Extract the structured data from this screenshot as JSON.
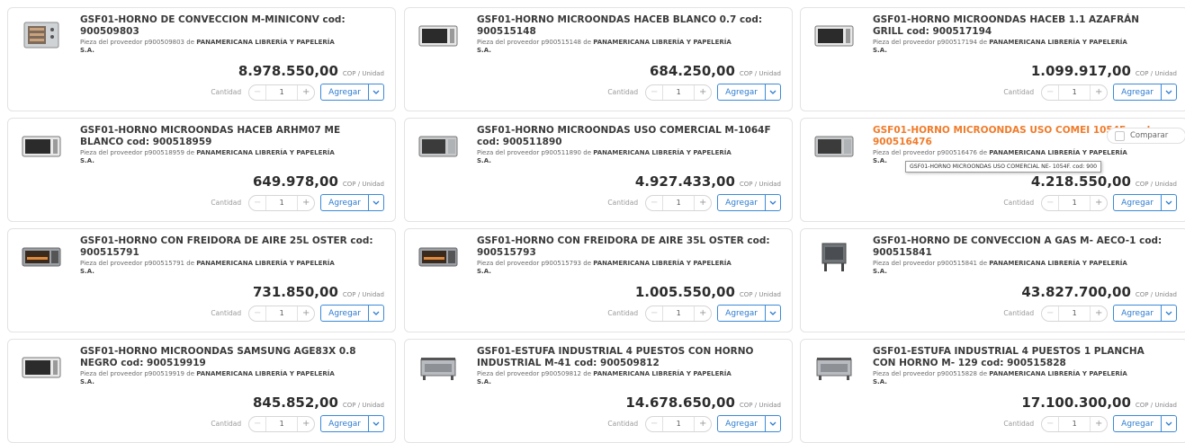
{
  "labels": {
    "provider_prefix": "Pieza del proveedor",
    "provider_of": "de",
    "unit": "COP / Unidad",
    "quantity": "Cantidad",
    "add": "Agregar",
    "compare": "Comparar",
    "minus": "−",
    "plus": "+"
  },
  "products": [
    {
      "title": "GSF01-HORNO DE CONVECCION M-MINICONV cod: 900509803",
      "provider_code": "p900509803",
      "provider": "PANAMERICANA LIBRERÍA Y PAPELERÍA S.A.",
      "price": "8.978.550,00",
      "qty": "1",
      "thumb": "convection-oven-icon",
      "highlighted": false
    },
    {
      "title": "GSF01-HORNO MICROONDAS HACEB BLANCO 0.7 cod: 900515148",
      "provider_code": "p900515148",
      "provider": "PANAMERICANA LIBRERÍA Y PAPELERÍA S.A.",
      "price": "684.250,00",
      "qty": "1",
      "thumb": "microwave-icon",
      "highlighted": false
    },
    {
      "title": "GSF01-HORNO MICROONDAS HACEB 1.1 AZAFRÁN GRILL cod: 900517194",
      "provider_code": "p900517194",
      "provider": "PANAMERICANA LIBRERÍA Y PAPELERÍA S.A.",
      "price": "1.099.917,00",
      "qty": "1",
      "thumb": "microwave-icon",
      "highlighted": false
    },
    {
      "title": "GSF01-HORNO MICROONDAS HACEB ARHM07 ME BLANCO cod: 900518959",
      "provider_code": "p900518959",
      "provider": "PANAMERICANA LIBRERÍA Y PAPELERÍA S.A.",
      "price": "649.978,00",
      "qty": "1",
      "thumb": "microwave-icon",
      "highlighted": false
    },
    {
      "title": "GSF01-HORNO MICROONDAS USO COMERCIAL M-1064F cod: 900511890",
      "provider_code": "p900511890",
      "provider": "PANAMERICANA LIBRERÍA Y PAPELERÍA S.A.",
      "price": "4.927.433,00",
      "qty": "1",
      "thumb": "commercial-microwave-icon",
      "highlighted": false
    },
    {
      "title": "GSF01-HORNO MICROONDAS USO COMEI 1054F. cod: 900516476",
      "provider_code": "p900516476",
      "provider": "PANAMERICANA LIBRERÍA Y PAPELERÍA S.A.",
      "price": "4.218.550,00",
      "qty": "1",
      "thumb": "commercial-microwave-icon",
      "highlighted": true,
      "tooltip": "GSF01-HORNO MICROONDAS USO COMERCIAL NE- 1054F. cod: 900"
    },
    {
      "title": "GSF01-HORNO CON FREIDORA DE AIRE 25L OSTER cod: 900515791",
      "provider_code": "p900515791",
      "provider": "PANAMERICANA LIBRERÍA Y PAPELERÍA S.A.",
      "price": "731.850,00",
      "qty": "1",
      "thumb": "toaster-oven-icon",
      "highlighted": false
    },
    {
      "title": "GSF01-HORNO CON FREIDORA DE AIRE 35L OSTER cod: 900515793",
      "provider_code": "p900515793",
      "provider": "PANAMERICANA LIBRERÍA Y PAPELERÍA S.A.",
      "price": "1.005.550,00",
      "qty": "1",
      "thumb": "toaster-oven-icon",
      "highlighted": false
    },
    {
      "title": "GSF01-HORNO DE CONVECCION A GAS M- AECO-1 cod: 900515841",
      "provider_code": "p900515841",
      "provider": "PANAMERICANA LIBRERÍA Y PAPELERÍA S.A.",
      "price": "43.827.700,00",
      "qty": "1",
      "thumb": "gas-oven-icon",
      "highlighted": false
    },
    {
      "title": "GSF01-HORNO MICROONDAS SAMSUNG AGE83X 0.8 NEGRO cod: 900519919",
      "provider_code": "p900519919",
      "provider": "PANAMERICANA LIBRERÍA Y PAPELERÍA S.A.",
      "price": "845.852,00",
      "qty": "1",
      "thumb": "microwave-icon",
      "highlighted": false
    },
    {
      "title": "GSF01-ESTUFA INDUSTRIAL 4 PUESTOS CON HORNO INDUSTRIAL M-41 cod: 900509812",
      "provider_code": "p900509812",
      "provider": "PANAMERICANA LIBRERÍA Y PAPELERÍA S.A.",
      "price": "14.678.650,00",
      "qty": "1",
      "thumb": "industrial-stove-icon",
      "highlighted": false
    },
    {
      "title": "GSF01-ESTUFA INDUSTRIAL 4 PUESTOS 1 PLANCHA CON HORNO M- 129 cod: 900515828",
      "provider_code": "p900515828",
      "provider": "PANAMERICANA LIBRERÍA Y PAPELERÍA S.A.",
      "price": "17.100.300,00",
      "qty": "1",
      "thumb": "industrial-stove-icon",
      "highlighted": false
    }
  ],
  "colors": {
    "accent": "#2c7cd1",
    "highlight": "#f07b2a"
  }
}
